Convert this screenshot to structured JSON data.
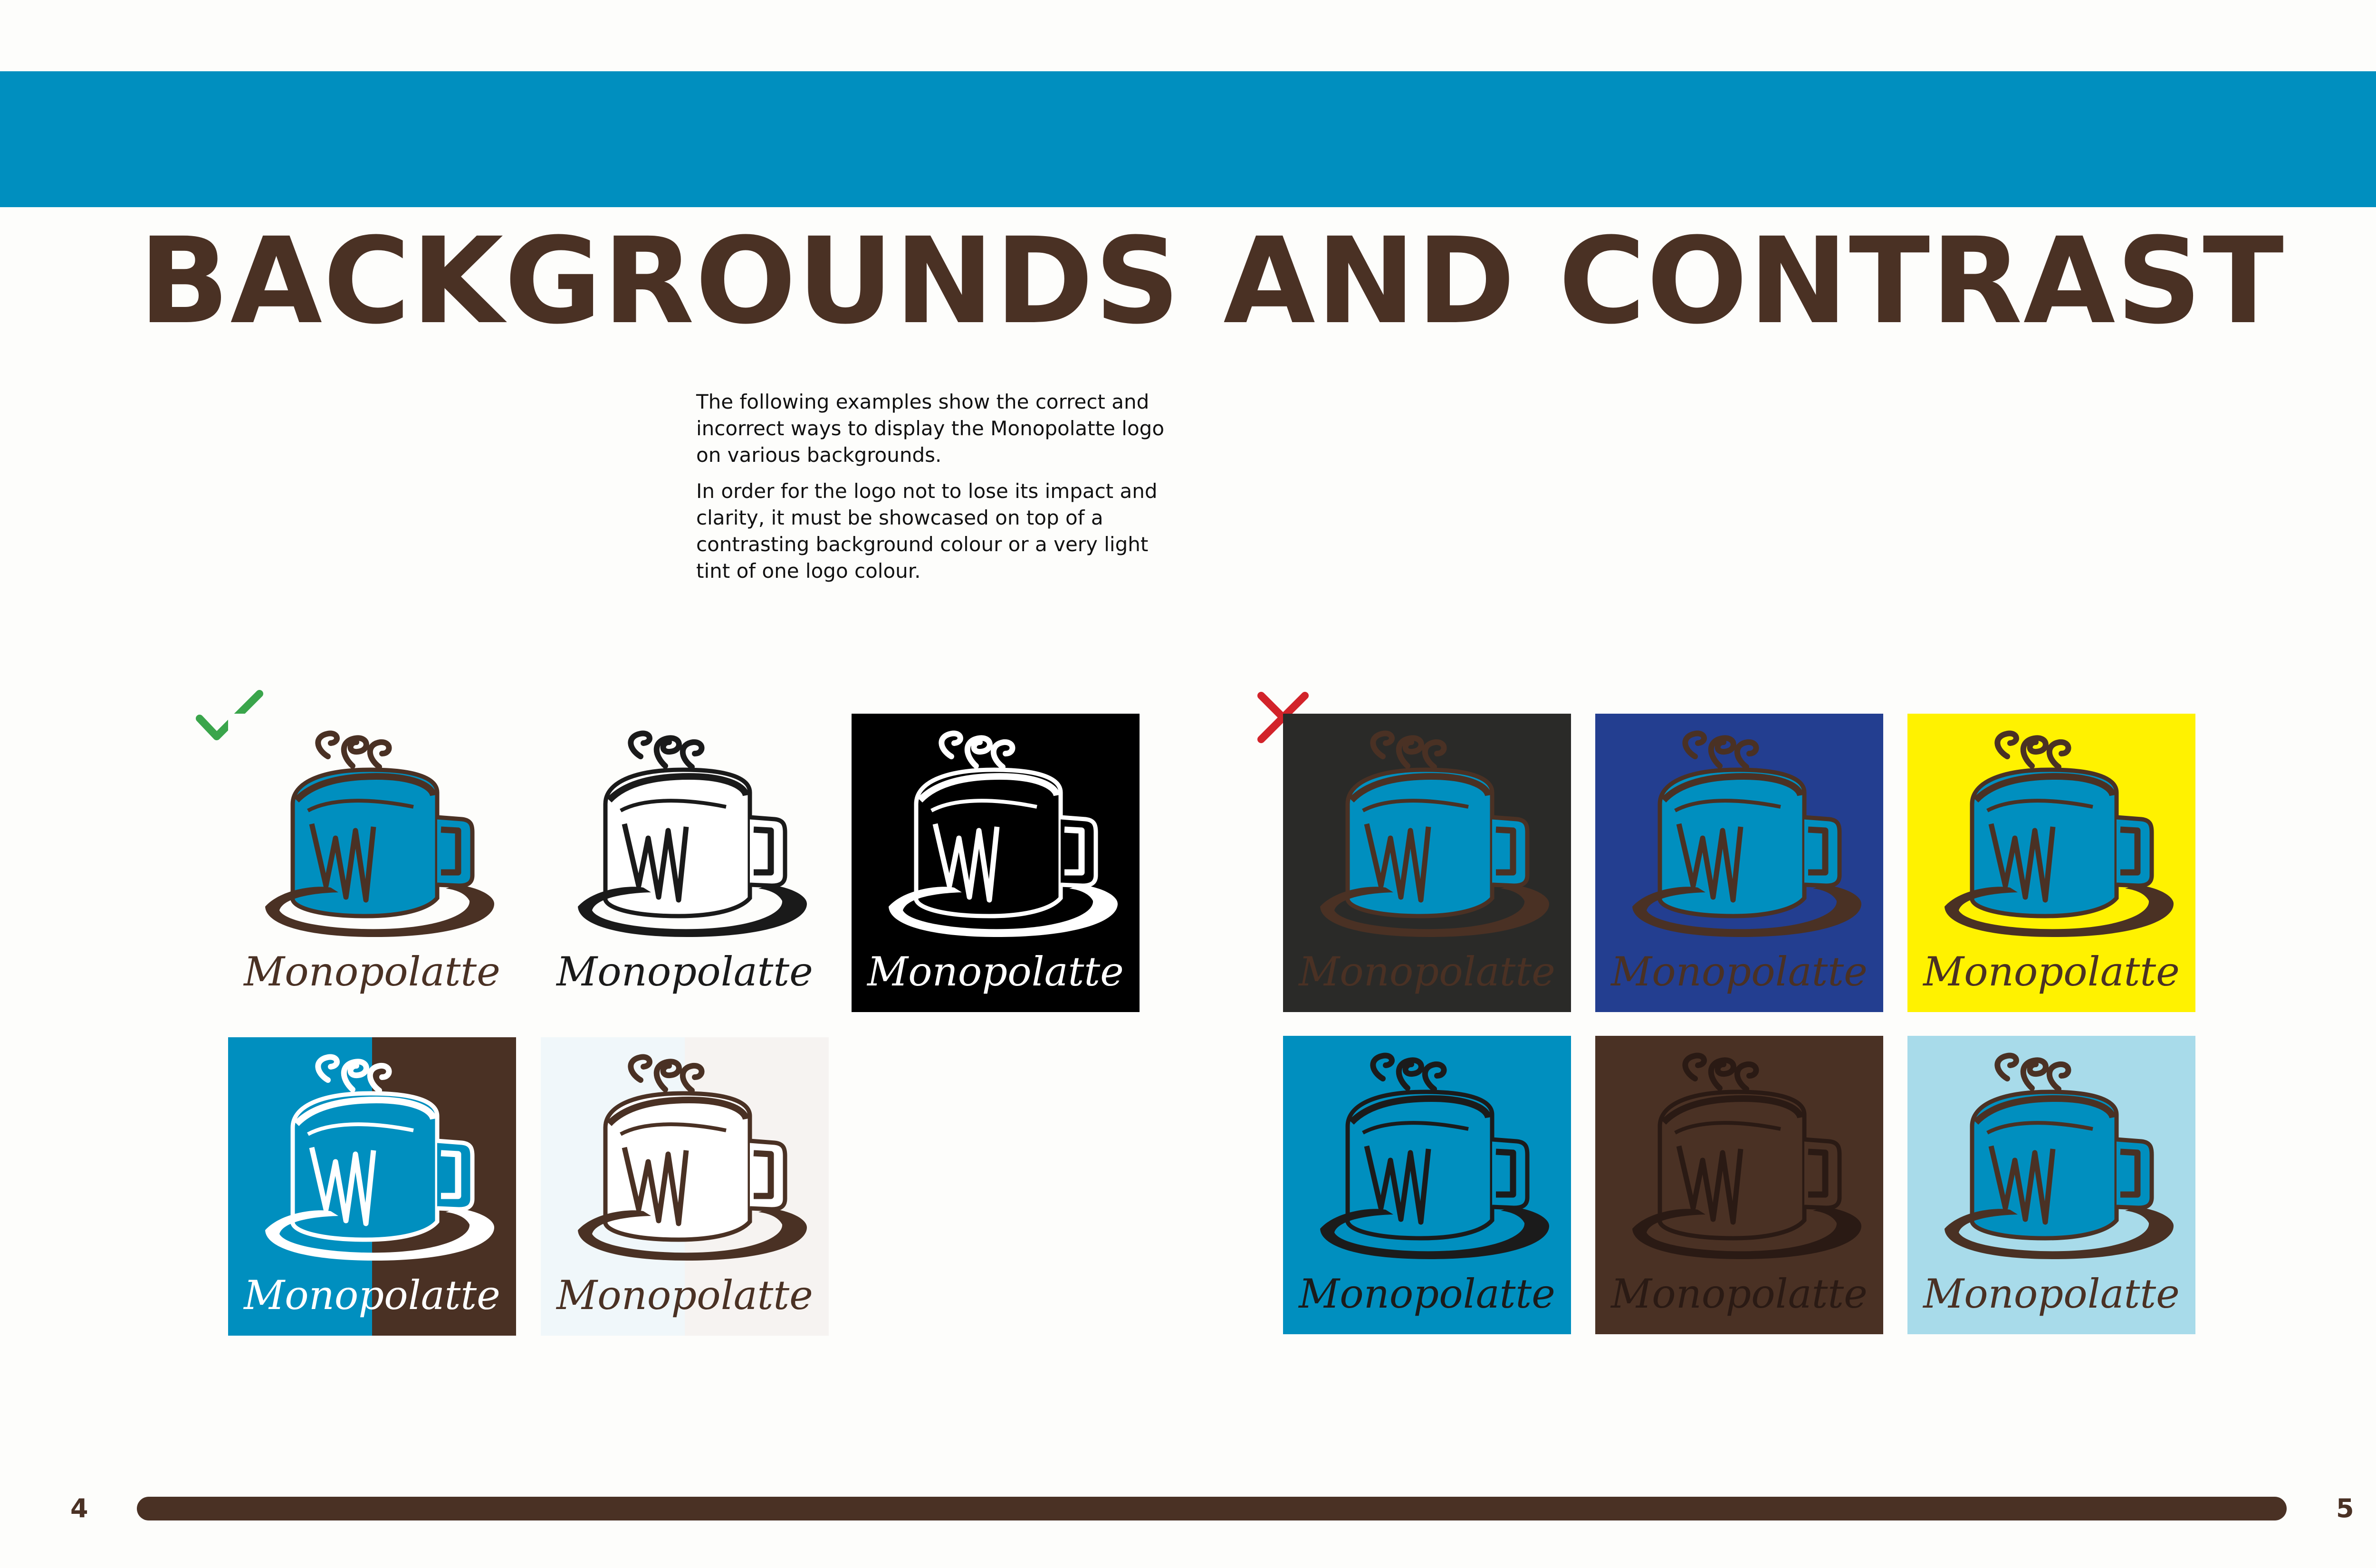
{
  "colors": {
    "blue": "#008fbf",
    "brown": "#4a3124",
    "white": "#ffffff",
    "black": "#000000",
    "check_green": "#3aa54b",
    "cross_red": "#d2232a"
  },
  "header": {
    "title": "BACKGROUNDS AND CONTRAST"
  },
  "intro": {
    "p1": "The following examples show the correct and incorrect ways to display the Monopolatte logo on various backgrounds.",
    "p2": "In order for the logo not to lose its impact and clarity, it must be showcased on top of a contrasting background colour or a very light tint of one logo colour."
  },
  "marks": {
    "correct_icon": "check-icon",
    "incorrect_icon": "cross-icon"
  },
  "logo_text": "Monopolatte",
  "correct": [
    {
      "bg": "#fdfdfb",
      "cup": "#008fbf",
      "ink": "#4a3124"
    },
    {
      "bg": "#fdfdfb",
      "cup": "#ffffff",
      "ink": "#1a1a1a"
    },
    {
      "bg": "#000000",
      "cup": "#000000",
      "ink": "#ffffff"
    },
    {
      "bg": "#008fbf",
      "bg2": "#4a3124",
      "cup": "#008fbf",
      "ink": "#ffffff"
    },
    {
      "bg": "#f0f7fa",
      "bg2": "#f6f3f1",
      "cup": "#ffffff",
      "ink": "#4a3124"
    }
  ],
  "incorrect": [
    {
      "bg": "#2a2a28",
      "cup": "#008fbf",
      "ink": "#4a3124"
    },
    {
      "bg": "#233e90",
      "cup": "#008fbf",
      "ink": "#4a3124"
    },
    {
      "bg": "#fff200",
      "cup": "#008fbf",
      "ink": "#4a3124"
    },
    {
      "bg": "#008fbf",
      "cup": "#008fbf",
      "ink": "#1b1b1b"
    },
    {
      "bg": "#4a3124",
      "cup": "#4a3124",
      "ink": "#2a1a14"
    },
    {
      "bg": "#a8dbea",
      "cup": "#008fbf",
      "ink": "#4a3124"
    }
  ],
  "footer": {
    "page_left": "4",
    "page_right": "5"
  }
}
